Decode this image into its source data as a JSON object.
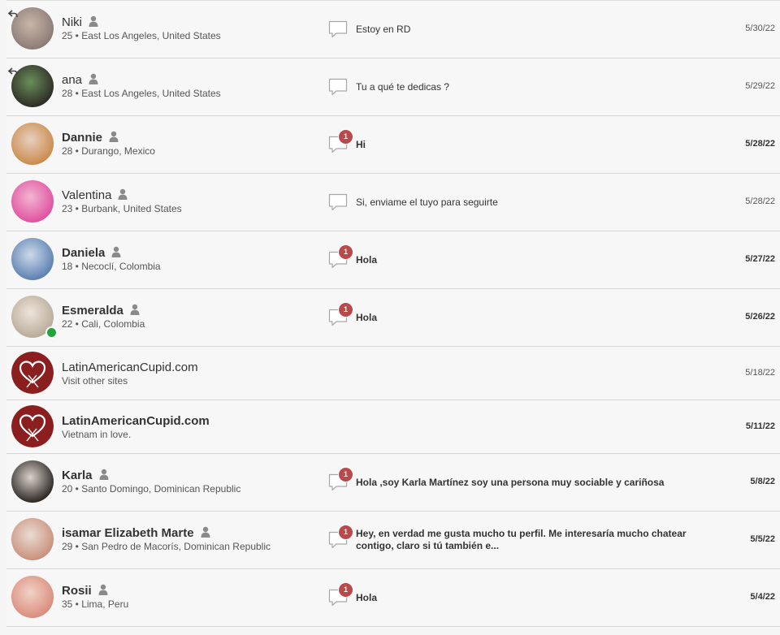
{
  "conversations": [
    {
      "name": "Niki",
      "details": "25 • East Los Angeles, United States",
      "message": "Estoy en RD",
      "date": "5/30/22",
      "badge": "",
      "unread": false,
      "replied": true,
      "online": false,
      "avatar_colors": [
        "#8a7a75",
        "#c9b6a8"
      ]
    },
    {
      "name": "ana",
      "details": "28 • East Los Angeles, United States",
      "message": "Tu a qué te dedicas ?",
      "date": "5/29/22",
      "badge": "",
      "unread": false,
      "replied": true,
      "online": false,
      "avatar_colors": [
        "#2c2a25",
        "#6b8e5a"
      ]
    },
    {
      "name": "Dannie",
      "details": "28 • Durango, Mexico",
      "message": "Hi",
      "date": "5/28/22",
      "badge": "1",
      "unread": true,
      "replied": false,
      "online": false,
      "avatar_colors": [
        "#c98a4a",
        "#e8cfc0"
      ]
    },
    {
      "name": "Valentina",
      "details": "23 • Burbank, United States",
      "message": "Si, enviame el tuyo para seguirte",
      "date": "5/28/22",
      "badge": "",
      "unread": false,
      "replied": false,
      "online": false,
      "avatar_colors": [
        "#e04fa0",
        "#f2b5d1"
      ]
    },
    {
      "name": "Daniela",
      "details": "18 • Necoclí, Colombia",
      "message": "Hola",
      "date": "5/27/22",
      "badge": "1",
      "unread": true,
      "replied": false,
      "online": false,
      "avatar_colors": [
        "#5a7fb0",
        "#cdd9ea"
      ]
    },
    {
      "name": "Esmeralda",
      "details": "22 • Cali, Colombia",
      "message": "Hola",
      "date": "5/26/22",
      "badge": "1",
      "unread": true,
      "replied": false,
      "online": true,
      "avatar_colors": [
        "#b8aa98",
        "#ede4da"
      ]
    },
    {
      "name": "LatinAmericanCupid.com",
      "details": "Visit other sites",
      "message": "",
      "date": "5/18/22",
      "badge": "",
      "unread": false,
      "replied": false,
      "online": false,
      "logo": true,
      "avatar_colors": [
        "#8b1e1e",
        "#a32a2a"
      ]
    },
    {
      "name": "LatinAmericanCupid.com",
      "details": "Vietnam in love.",
      "message": "",
      "date": "5/11/22",
      "badge": "",
      "unread": true,
      "replied": false,
      "online": false,
      "logo": true,
      "avatar_colors": [
        "#8b1e1e",
        "#a32a2a"
      ]
    },
    {
      "name": "Karla",
      "details": "20 • Santo Domingo, Dominican Republic",
      "message": "Hola ,soy Karla Martínez soy una persona muy sociable y cariñosa",
      "date": "5/8/22",
      "badge": "1",
      "unread": true,
      "replied": false,
      "online": false,
      "avatar_colors": [
        "#2a2420",
        "#d9d2cc"
      ]
    },
    {
      "name": "isamar Elizabeth Marte",
      "details": "29 • San Pedro de Macorís, Dominican Republic",
      "message": "Hey, en verdad me gusta mucho tu perfil. Me interesaría mucho chatear contigo, claro si tú también e...",
      "date": "5/5/22",
      "badge": "1",
      "unread": true,
      "replied": false,
      "online": false,
      "avatar_colors": [
        "#c98f7a",
        "#e9dcd4"
      ]
    },
    {
      "name": "Rosii",
      "details": "35 • Lima, Peru",
      "message": "Hola",
      "date": "5/4/22",
      "badge": "1",
      "unread": true,
      "replied": false,
      "online": false,
      "avatar_colors": [
        "#d98b7a",
        "#f1d2c8"
      ]
    }
  ]
}
